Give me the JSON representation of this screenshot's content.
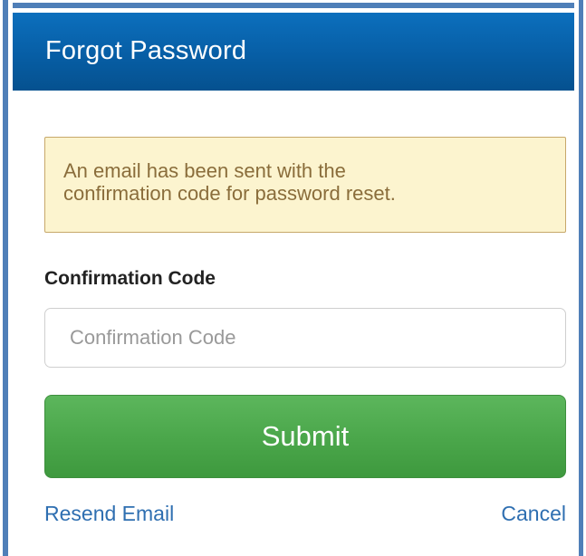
{
  "dialog": {
    "title": "Forgot Password"
  },
  "alert": {
    "message_line1": "An email has been sent with the",
    "message_line2": "confirmation code for password reset."
  },
  "form": {
    "code_label": "Confirmation Code",
    "code_placeholder": "Confirmation Code",
    "code_value": "",
    "submit_label": "Submit"
  },
  "links": {
    "resend": "Resend Email",
    "cancel": "Cancel"
  },
  "colors": {
    "header": "#075ea5",
    "alert_bg": "#fcf4cf",
    "alert_text": "#8a6d3b",
    "submit": "#4aa64a",
    "link": "#2f6fb1"
  }
}
